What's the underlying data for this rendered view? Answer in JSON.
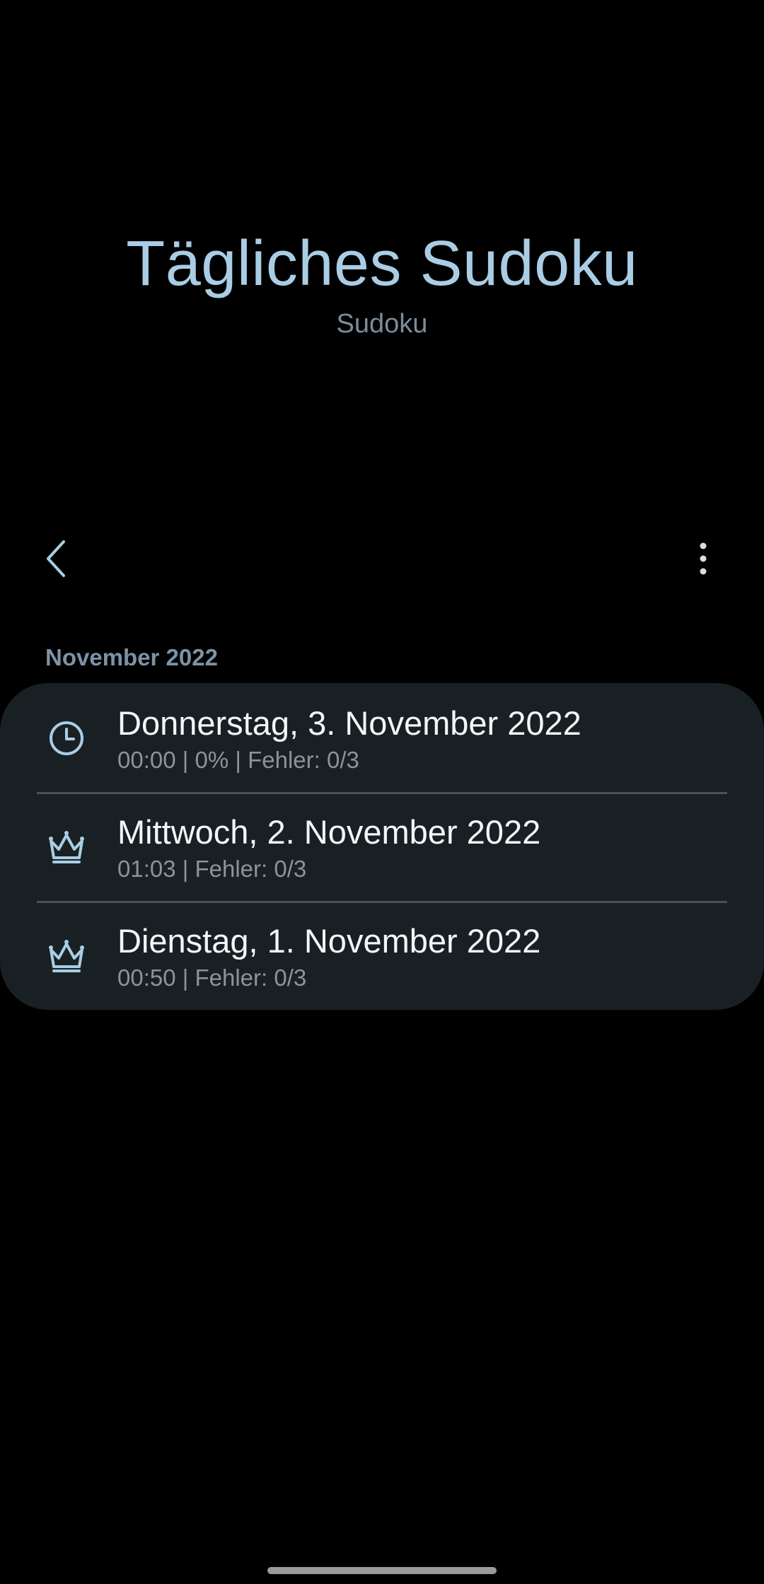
{
  "app": {
    "title": "Tägliches Sudoku",
    "subtitle": "Sudoku"
  },
  "toolbar": {
    "back_icon": "chevron-left-icon",
    "more_icon": "more-vertical-icon"
  },
  "section": {
    "header": "November 2022"
  },
  "games": [
    {
      "icon": "clock-icon",
      "date": "Donnerstag, 3. November 2022",
      "details": "00:00 | 0% | Fehler: 0/3"
    },
    {
      "icon": "crown-icon",
      "date": "Mittwoch, 2. November 2022",
      "details": "01:03 | Fehler: 0/3"
    },
    {
      "icon": "crown-icon",
      "date": "Dienstag, 1. November 2022",
      "details": "00:50 | Fehler: 0/3"
    }
  ],
  "colors": {
    "accent": "#a9cde4",
    "card_background": "#192024",
    "background": "#000000"
  }
}
